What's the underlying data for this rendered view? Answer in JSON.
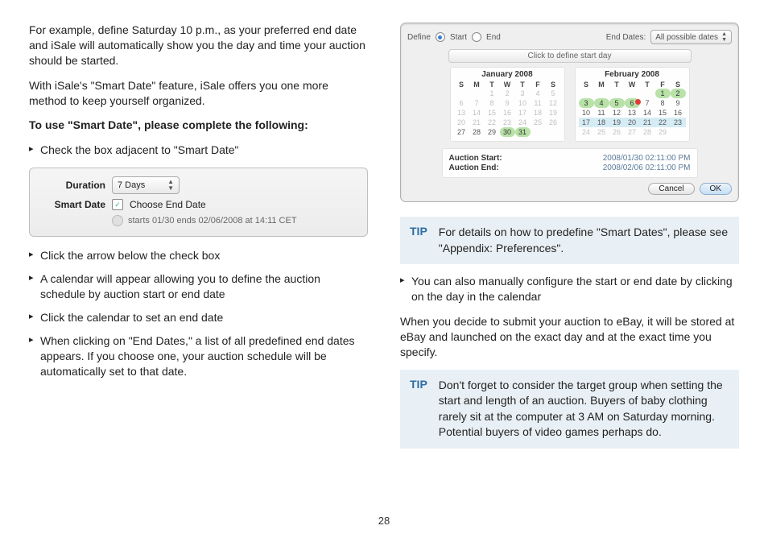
{
  "pageNumber": "28",
  "left": {
    "para1": "For example, define Saturday 10 p.m., as your preferred end date and iSale will automatically show you the day and time your auction should be started.",
    "para2": "With iSale's \"Smart Date\" feature, iSale offers you one more method to keep yourself organized.",
    "heading": "To use \"Smart Date\", please complete the following:",
    "step1": "Check the box adjacent to \"Smart Date\"",
    "panel": {
      "durationLabel": "Duration",
      "durationValue": "7 Days",
      "smartDateLabel": "Smart Date",
      "chooseEnd": "Choose End Date",
      "sub": "starts 01/30 ends 02/06/2008 at 14:11 CET"
    },
    "step2": "Click the arrow below the check box",
    "step3": "A calendar will appear allowing you to define the auction schedule by auction start or end date",
    "step4": "Click the calendar to set an end date",
    "step5": "When clicking on \"End Dates,\" a list of all predefined end dates appears. If you choose one, your auction schedule will be automatically set to that date."
  },
  "right": {
    "dialog": {
      "defineLabel": "Define",
      "startLabel": "Start",
      "endLabel": "End",
      "endDatesLabel": "End Dates:",
      "endDatesValue": "All possible dates",
      "clickHint": "Click to define start day",
      "month1": {
        "title": "January 2008",
        "dow": [
          "S",
          "M",
          "T",
          "W",
          "T",
          "F",
          "S"
        ]
      },
      "month2": {
        "title": "February 2008",
        "dow": [
          "S",
          "M",
          "T",
          "W",
          "T",
          "F",
          "S"
        ]
      },
      "auctionStartLabel": "Auction Start:",
      "auctionStartValue": "2008/01/30  02:11:00 PM",
      "auctionEndLabel": "Auction End:",
      "auctionEndValue": "2008/02/06  02:11:00 PM",
      "cancel": "Cancel",
      "ok": "OK"
    },
    "tip1": "For details on how to predefine \"Smart Dates\", please see \"Appendix: Preferences\".",
    "bullet": "You can also manually configure the start or end date by clicking on the day in the calendar",
    "para": "When you decide to submit your auction to eBay, it will be stored at eBay and launched on the exact day and at the exact time you specify.",
    "tip2": "Don't forget to consider the target group when setting the start and length of an auction. Buyers of baby clothing rarely sit at the computer at 3 AM on Saturday morning. Potential buyers of video games perhaps do.",
    "tipLabel": "TIP"
  }
}
